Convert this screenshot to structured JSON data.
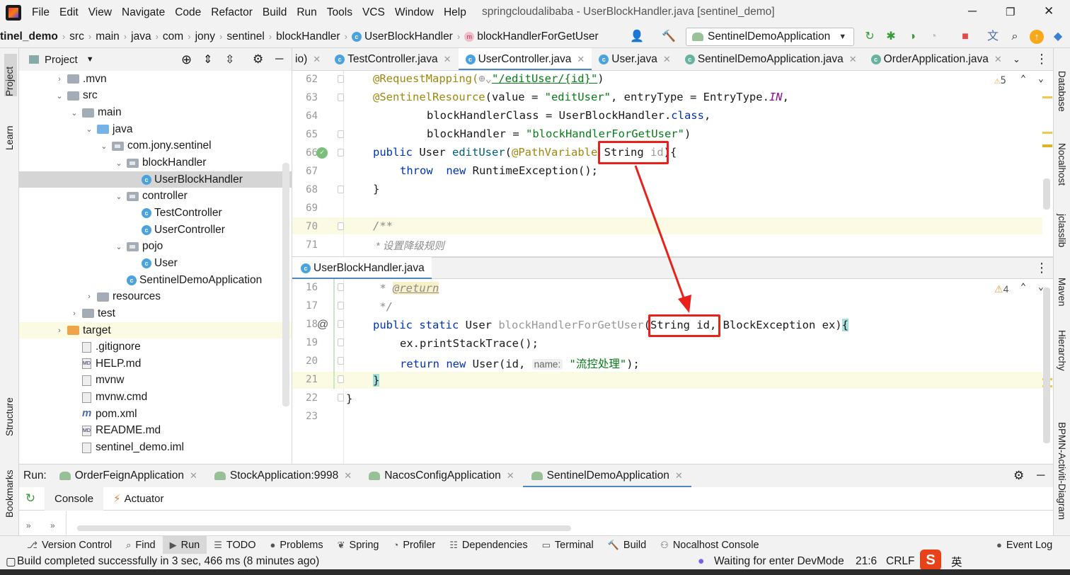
{
  "menubar": {
    "items": [
      "File",
      "Edit",
      "View",
      "Navigate",
      "Code",
      "Refactor",
      "Build",
      "Run",
      "Tools",
      "VCS",
      "Window",
      "Help"
    ],
    "title": "springcloudalibaba - UserBlockHandler.java [sentinel_demo]"
  },
  "breadcrumb": [
    "tinel_demo",
    "src",
    "main",
    "java",
    "com",
    "jony",
    "sentinel",
    "blockHandler",
    "UserBlockHandler",
    "blockHandlerForGetUser"
  ],
  "run_config": "SentinelDemoApplication",
  "left_strip": {
    "project": "Project",
    "learn": "Learn",
    "structure": "Structure",
    "bookmarks": "Bookmarks"
  },
  "right_strip": [
    "Database",
    "Nocalhost",
    "jclasslib",
    "Maven",
    "Hierarchy",
    "BPMN-Activiti-Diagram"
  ],
  "project": {
    "header": "Project",
    "tree": [
      {
        "label": ".mvn",
        "level": 2,
        "arrow": ">",
        "type": "folder"
      },
      {
        "label": "src",
        "level": 2,
        "arrow": "v",
        "type": "folder"
      },
      {
        "label": "main",
        "level": 3,
        "arrow": "v",
        "type": "folder"
      },
      {
        "label": "java",
        "level": 4,
        "arrow": "v",
        "type": "folder-blue"
      },
      {
        "label": "com.jony.sentinel",
        "level": 5,
        "arrow": "v",
        "type": "package"
      },
      {
        "label": "blockHandler",
        "level": 6,
        "arrow": "v",
        "type": "package"
      },
      {
        "label": "UserBlockHandler",
        "level": 7,
        "arrow": "",
        "type": "class",
        "selected": true
      },
      {
        "label": "controller",
        "level": 6,
        "arrow": "v",
        "type": "package"
      },
      {
        "label": "TestController",
        "level": 7,
        "arrow": "",
        "type": "class"
      },
      {
        "label": "UserController",
        "level": 7,
        "arrow": "",
        "type": "class"
      },
      {
        "label": "pojo",
        "level": 6,
        "arrow": "v",
        "type": "package"
      },
      {
        "label": "User",
        "level": 7,
        "arrow": "",
        "type": "class"
      },
      {
        "label": "SentinelDemoApplication",
        "level": 6,
        "arrow": "",
        "type": "class"
      },
      {
        "label": "resources",
        "level": 4,
        "arrow": ">",
        "type": "folder"
      },
      {
        "label": "test",
        "level": 3,
        "arrow": ">",
        "type": "folder"
      },
      {
        "label": "target",
        "level": 2,
        "arrow": ">",
        "type": "folder-orange",
        "highlight": true
      },
      {
        "label": ".gitignore",
        "level": 3,
        "arrow": "",
        "type": "file"
      },
      {
        "label": "HELP.md",
        "level": 3,
        "arrow": "",
        "type": "md"
      },
      {
        "label": "mvnw",
        "level": 3,
        "arrow": "",
        "type": "file"
      },
      {
        "label": "mvnw.cmd",
        "level": 3,
        "arrow": "",
        "type": "file"
      },
      {
        "label": "pom.xml",
        "level": 3,
        "arrow": "",
        "type": "maven"
      },
      {
        "label": "README.md",
        "level": 3,
        "arrow": "",
        "type": "md"
      },
      {
        "label": "sentinel_demo.iml",
        "level": 3,
        "arrow": "",
        "type": "file"
      }
    ]
  },
  "editor_tabs": [
    {
      "label": "TestController.java",
      "active": false
    },
    {
      "label": "UserController.java",
      "active": true
    },
    {
      "label": "User.java",
      "active": false
    },
    {
      "label": "SentinelDemoApplication.java",
      "active": false
    },
    {
      "label": "OrderApplication.java",
      "active": false
    }
  ],
  "editor_tab_partial": "io)",
  "upper_editor": {
    "warnings": "5",
    "lines": [
      "62",
      "63",
      "64",
      "65",
      "66",
      "67",
      "68",
      "69",
      "70",
      "71"
    ]
  },
  "lower_editor": {
    "tab": "UserBlockHandler.java",
    "warnings": "4",
    "lines": [
      "16",
      "17",
      "18",
      "19",
      "20",
      "21",
      "22",
      "23"
    ]
  },
  "code_text": {
    "l62_ann": "@RequestMapping(",
    "l62_str": "\"/editUser/{id}\"",
    "l62_end": ")",
    "l63_ann": "@SentinelResource",
    "l63_a": "(value = ",
    "l63_str": "\"editUser\"",
    "l63_b": ", entryType = EntryType.",
    "l63_c": "IN",
    "l63_d": ",",
    "l64_a": "blockHandlerClass = UserBlockHandler.",
    "l64_kw": "class",
    "l64_b": ",",
    "l65_a": "blockHandler = ",
    "l65_str": "\"blockHandlerForGetUser\"",
    "l65_b": ")",
    "l66_kw": "public",
    "l66_type": " User ",
    "l66_fn": "editUser",
    "l66_paren": "(",
    "l66_ann": "@PathVariable",
    "l66_param": " String ",
    "l66_id": "id",
    "l66_end": "){",
    "l67_kw1": "throw",
    "l67_kw2": "new",
    "l67_rest": " RuntimeException();",
    "l68": "}",
    "l70": "/**",
    "l71": " * 设置降级规则",
    "l16_a": " * ",
    "l16_tag": "@return",
    "l17": " */",
    "l18_kw1": "public",
    "l18_kw2": "static",
    "l18_type": " User ",
    "l18_fn": "blockHandlerForGetUser",
    "l18_params": "(String id, BlockException ex)",
    "l18_brace": "{",
    "l19": "ex.printStackTrace();",
    "l20_kw1": "return",
    "l20_kw2": "new",
    "l20_a": " User(id, ",
    "l20_hint": "name:",
    "l20_str": "\"流控处理\"",
    "l20_b": ");",
    "l21": "}",
    "l22": "}"
  },
  "run_panel": {
    "label": "Run:",
    "tabs": [
      {
        "label": "OrderFeignApplication",
        "active": false
      },
      {
        "label": "StockApplication:9998",
        "active": false
      },
      {
        "label": "NacosConfigApplication",
        "active": false
      },
      {
        "label": "SentinelDemoApplication",
        "active": true
      }
    ],
    "console_tabs": [
      "Console",
      "Actuator"
    ]
  },
  "tool_windows": [
    "Version Control",
    "Find",
    "Run",
    "TODO",
    "Problems",
    "Spring",
    "Profiler",
    "Dependencies",
    "Terminal",
    "Build",
    "Nocalhost Console",
    "Event Log"
  ],
  "status": {
    "message": "Build completed successfully in 3 sec, 466 ms (8 minutes ago)",
    "devmode": "Waiting for enter DevMode",
    "position": "21:6",
    "line_sep": "CRLF",
    "ime": "英"
  },
  "colors": {
    "accent": "#4a88c7",
    "annotation_box": "#e8221b",
    "keyword": "#0033b3",
    "string": "#067d17"
  }
}
